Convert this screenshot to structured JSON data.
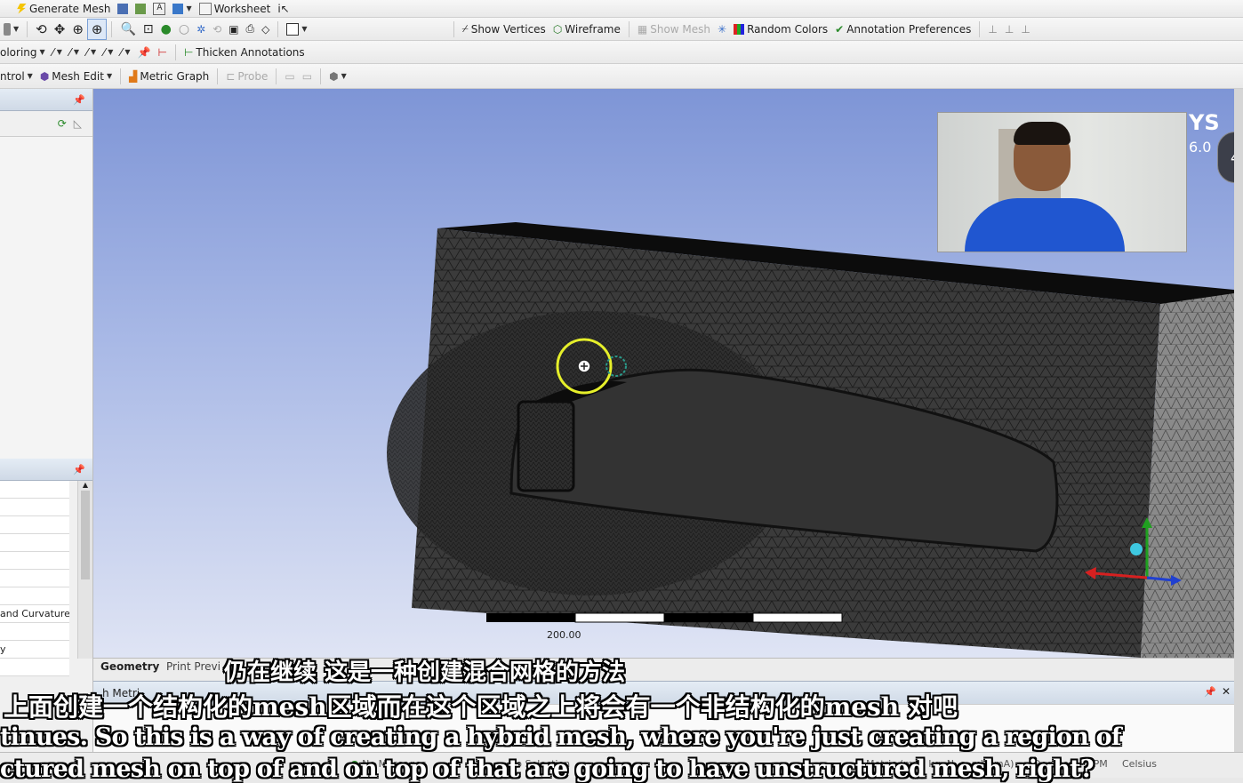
{
  "toolbar1": {
    "generate_mesh": "Generate Mesh",
    "worksheet": "Worksheet"
  },
  "toolbar2": {
    "show_vertices": "Show Vertices",
    "wireframe": "Wireframe",
    "show_mesh": "Show Mesh",
    "random_colors": "Random Colors",
    "annotation_preferences": "Annotation Preferences"
  },
  "toolbar3": {
    "coloring": "oloring",
    "thicken_annotations": "Thicken Annotations"
  },
  "toolbar4": {
    "control": "ntrol",
    "mesh_edit": "Mesh Edit",
    "metric_graph": "Metric Graph",
    "probe": "Probe"
  },
  "left_panel": {
    "details_rows": [
      "and Curvature",
      "y"
    ]
  },
  "viewport": {
    "brand_tail": "YS",
    "version_tail": "6.0",
    "scale_label": "200.00",
    "badge": "4"
  },
  "tabs": {
    "geometry": "Geometry",
    "print_preview": "Print Previ"
  },
  "bottom_panel": {
    "title": "h Metri"
  },
  "status": {
    "messages": "No Messages",
    "selection": "No Selection",
    "units": "Metric (mm, kg, N, s, mV, mA)",
    "degrees": "Degrees",
    "rpm": "RPM",
    "celsius": "Celsius"
  },
  "subtitles": {
    "line1": "仍在继续 这是一种创建混合网格的方法",
    "line2": "上面创建一个结构化的mesh区域而在这个区域之上将会有一个非结构化的mesh 对吧",
    "line3": "tinues. So this is a way of creating a hybrid mesh, where you're just creating a region of",
    "line4": "ctured mesh on top of and on top of that are going to have unstructured mesh, right?"
  },
  "colors": {
    "viewport_top": "#7e95d6",
    "viewport_bottom": "#dfe4f4",
    "mesh_face": "#3a3a3a",
    "axis_x": "#d62020",
    "axis_y": "#20a020",
    "axis_z": "#2040d0",
    "highlight": "#e6ef2a"
  }
}
